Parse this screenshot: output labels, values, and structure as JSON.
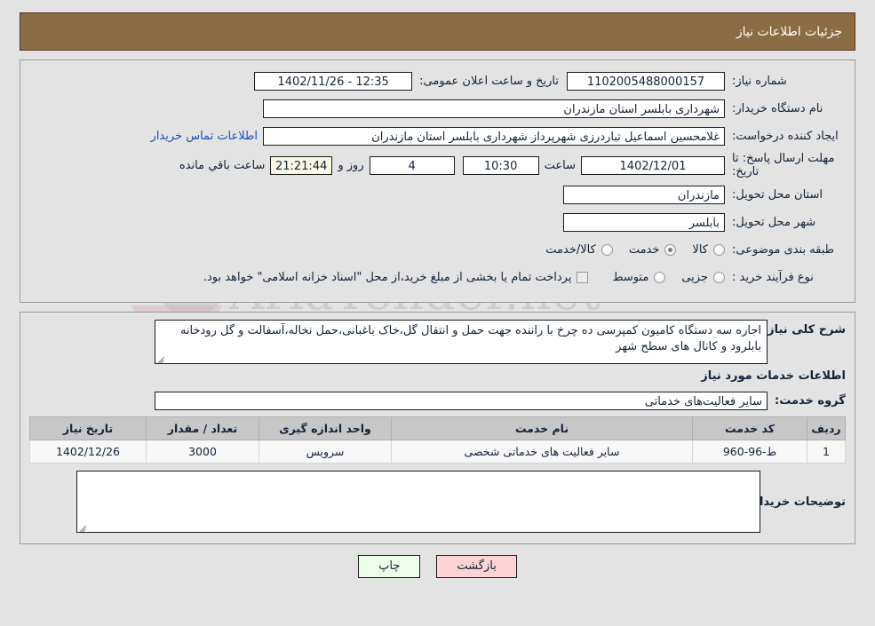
{
  "header": {
    "title": "جزئیات اطلاعات نیاز"
  },
  "form": {
    "need_number_label": "شماره نیاز:",
    "need_number_value": "1102005488000157",
    "announce_label": "تاریخ و ساعت اعلان عمومی:",
    "announce_value": "12:35 - 1402/11/26",
    "buyer_org_label": "نام دستگاه خریدار:",
    "buyer_org_value": "شهرداری بابلسر استان مازندران",
    "creator_label": "ایجاد کننده درخواست:",
    "creator_value": "غلامحسین اسماعیل تباردرزی شهرپرداز شهرداری بابلسر استان مازندران",
    "contact_link": "اطلاعات تماس خریدار",
    "deadline_label": "مهلت ارسال پاسخ: تا تاریخ:",
    "deadline_date": "1402/12/01",
    "hour_label": "ساعت",
    "deadline_time": "10:30",
    "days_value": "4",
    "days_label": "روز و",
    "countdown_value": "21:21:44",
    "remaining_label": "ساعت باقي مانده",
    "province_label": "استان محل تحویل:",
    "province_value": "مازندران",
    "city_label": "شهر محل تحویل:",
    "city_value": "بابلسر",
    "category_label": "طبقه بندی موضوعی:",
    "category_options": [
      {
        "label": "کالا",
        "checked": false
      },
      {
        "label": "خدمت",
        "checked": true
      },
      {
        "label": "کالا/خدمت",
        "checked": false
      }
    ],
    "process_label": "نوع فرآیند خرید :",
    "process_options": [
      {
        "label": "جزیی",
        "checked": false
      },
      {
        "label": "متوسط",
        "checked": false
      }
    ],
    "treasury_note": "پرداخت تمام یا بخشی از مبلغ خرید،از محل \"اسناد خزانه اسلامی\" خواهد بود."
  },
  "details": {
    "summary_label": "شرح کلی نیاز:",
    "summary_value": "اجاره سه دستگاه کامیون کمپرسی ده چرخ با راننده جهت حمل و انتقال گل،خاک باغبانی،حمل نخاله،آسفالت و گل رودخانه بابلرود و کانال های سطح شهر",
    "services_title": "اطلاعات خدمات مورد نیاز",
    "service_group_label": "گروه خدمت:",
    "service_group_value": "سایر فعالیت‌های خدماتی",
    "table": {
      "columns": [
        "ردیف",
        "کد خدمت",
        "نام خدمت",
        "واحد اندازه گیری",
        "تعداد / مقدار",
        "تاریخ نیاز"
      ],
      "rows": [
        [
          "1",
          "ط-96-960",
          "سایر فعالیت های خدماتی شخصی",
          "سرویس",
          "3000",
          "1402/12/26"
        ]
      ]
    },
    "buyer_notes_label": "توضیحات خریدار:",
    "buyer_notes_value": ""
  },
  "buttons": {
    "print": "چاپ",
    "back": "بازگشت"
  },
  "watermark": {
    "text": "AriaTender.net"
  },
  "colors": {
    "header_bg": "#8c6c43",
    "link": "#1a4fc0",
    "countdown_bg": "#fbf8e6",
    "print_bg": "#ebffe8",
    "back_bg": "#fbd3d3"
  }
}
